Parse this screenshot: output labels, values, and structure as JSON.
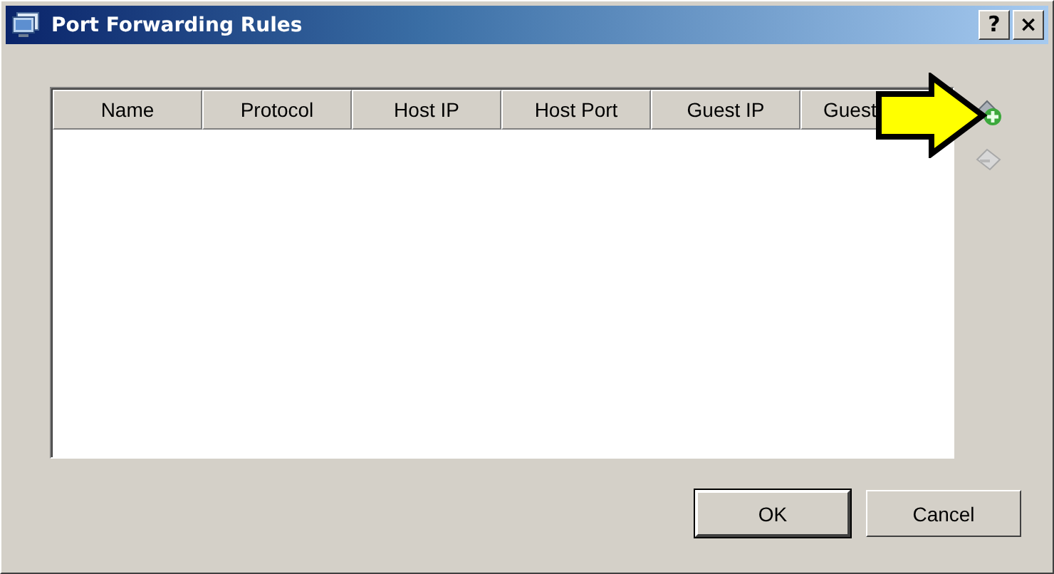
{
  "window": {
    "title": "Port Forwarding Rules",
    "title_buttons": [
      "?",
      "×"
    ]
  },
  "table": {
    "columns": [
      "Name",
      "Protocol",
      "Host IP",
      "Host Port",
      "Guest IP",
      "Guest"
    ]
  },
  "buttons": [
    {
      "label": "OK",
      "default": true
    },
    {
      "label": "Cancel",
      "default": false
    }
  ]
}
